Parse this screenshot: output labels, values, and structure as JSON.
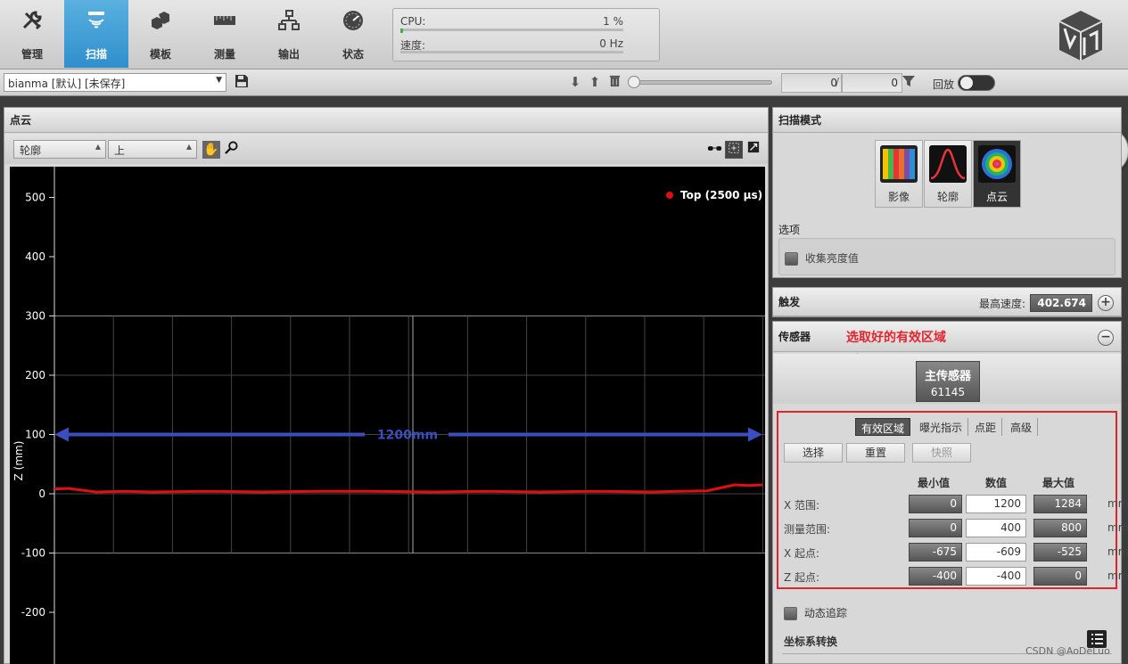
{
  "nav": {
    "items": [
      {
        "label": "管理",
        "icon": "tools-icon"
      },
      {
        "label": "扫描",
        "icon": "scan-icon"
      },
      {
        "label": "模板",
        "icon": "template-icon"
      },
      {
        "label": "测量",
        "icon": "ruler-icon"
      },
      {
        "label": "输出",
        "icon": "network-icon"
      },
      {
        "label": "状态",
        "icon": "gauge-icon"
      }
    ],
    "active_index": 1
  },
  "system": {
    "cpu_label": "CPU:",
    "cpu_value": "1 %",
    "cpu_fraction": 0.01,
    "speed_label": "速度:",
    "speed_value": "0 Hz",
    "speed_fraction": 0
  },
  "toolbar": {
    "job_name": "bianma [默认] [未保存]",
    "frame_current": "0",
    "frame_separator": "/",
    "frame_total": "0",
    "replay_label": "回放",
    "replay_on": false
  },
  "pointcloud_panel": {
    "title": "点云",
    "view_mode": "轮廓",
    "view_source": "上"
  },
  "chart_data": {
    "type": "line",
    "ylabel": "Z (mm)",
    "ylim": [
      -250,
      550
    ],
    "xlim": [
      -675,
      600
    ],
    "y_ticks": [
      500,
      400,
      300,
      200,
      100,
      0,
      -100,
      -200
    ],
    "legend": {
      "entries": [
        "Top (2500 µs)"
      ],
      "placement": "top-right"
    },
    "grid": true,
    "series": [
      {
        "name": "Top (2500 µs)",
        "color": "#e01010",
        "x": [
          -675,
          -650,
          -625,
          -600,
          -550,
          -500,
          -400,
          -300,
          -200,
          -100,
          0,
          100,
          200,
          300,
          400,
          450,
          500,
          525,
          550,
          575,
          600
        ],
        "y": [
          8,
          9,
          6,
          3,
          4,
          3,
          4,
          3,
          4,
          4,
          3,
          4,
          3,
          4,
          3,
          4,
          5,
          10,
          15,
          14,
          15
        ]
      }
    ],
    "annotation": {
      "text": "1200mm",
      "color": "#3a4ec0",
      "y": 100,
      "x_from": -675,
      "x_to": 600
    }
  },
  "scan_mode": {
    "title": "扫描模式",
    "modes": [
      {
        "label": "影像",
        "icon": "image-mode-icon"
      },
      {
        "label": "轮廓",
        "icon": "profile-mode-icon"
      },
      {
        "label": "点云",
        "icon": "pointcloud-mode-icon"
      }
    ],
    "active_index": 2,
    "options_title": "选项",
    "collect_intensity_label": "收集亮度值"
  },
  "trigger": {
    "title": "触发",
    "max_speed_label": "最高速度:",
    "max_speed_value": "402.674"
  },
  "sensor": {
    "title": "传感器",
    "annotation": "选取好的有效区域",
    "annotation_color": "#e0252f",
    "main_sensor_label": "主传感器",
    "main_sensor_serial": "61145",
    "tabs": [
      "有效区域",
      "曝光指示",
      "点距",
      "高级"
    ],
    "active_tab": 0,
    "buttons": {
      "select": "选择",
      "reset": "重置",
      "snapshot": "快照"
    },
    "columns": {
      "min": "最小值",
      "value": "数值",
      "max": "最大值"
    },
    "rows": [
      {
        "label": "X 范围:",
        "min": "0",
        "value": "1200",
        "max": "1284",
        "unit": "mm"
      },
      {
        "label": "测量范围:",
        "min": "0",
        "value": "400",
        "max": "800",
        "unit": "mm"
      },
      {
        "label": "X 起点:",
        "min": "-675",
        "value": "-609",
        "max": "-525",
        "unit": "mm"
      },
      {
        "label": "Z 起点:",
        "min": "-400",
        "value": "-400",
        "max": "0",
        "unit": "mm"
      }
    ],
    "dynamic_tracking_label": "动态追踪",
    "coord_transform_label": "坐标系转换"
  },
  "watermark": "CSDN @AoDeLuo"
}
